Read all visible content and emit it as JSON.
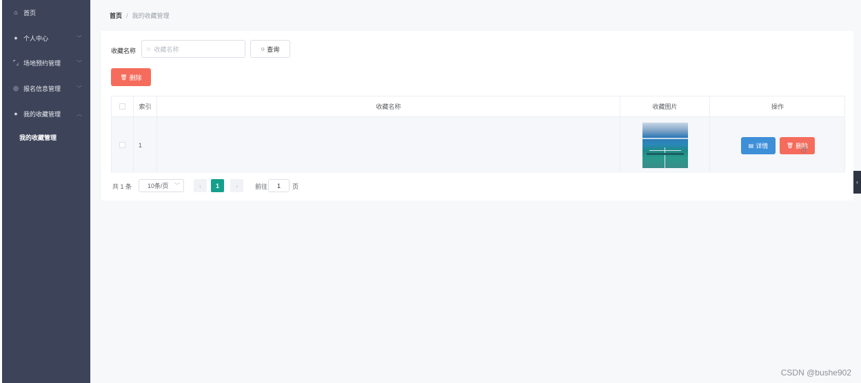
{
  "sidebar": {
    "items": [
      {
        "label": "首页",
        "icon": "home-icon",
        "glyph": "⌂"
      },
      {
        "label": "个人中心",
        "icon": "user-icon",
        "glyph": "●"
      },
      {
        "label": "场地预约管理",
        "icon": "crop-icon",
        "glyph": "⌜⌟"
      },
      {
        "label": "报名信息管理",
        "icon": "compass-icon",
        "glyph": "◎"
      },
      {
        "label": "我的收藏管理",
        "icon": "user-icon",
        "glyph": "●"
      }
    ],
    "sub_item": "我的收藏管理"
  },
  "breadcrumb": {
    "home": "首页",
    "separator": "/",
    "current": "我的收藏管理"
  },
  "search": {
    "label": "收藏名称",
    "placeholder": "收藏名称",
    "button": "查询"
  },
  "toolbar": {
    "delete_label": "删除"
  },
  "table": {
    "headers": [
      "",
      "索引",
      "收藏名称",
      "收藏图片",
      "操作"
    ],
    "rows": [
      {
        "index": "1",
        "name": "",
        "detail_label": "详情",
        "delete_label": "删除"
      }
    ]
  },
  "pagination": {
    "total": "共 1 条",
    "page_size": "10条/页",
    "current": "1",
    "goto_label": "前往",
    "goto_value": "1",
    "page_suffix": "页"
  },
  "watermark": "CSDN @bushe902",
  "colors": {
    "sidebar": "#3d4459",
    "danger": "#f56c5c",
    "primary": "#3d8fd8",
    "active_page": "#14a08c"
  }
}
